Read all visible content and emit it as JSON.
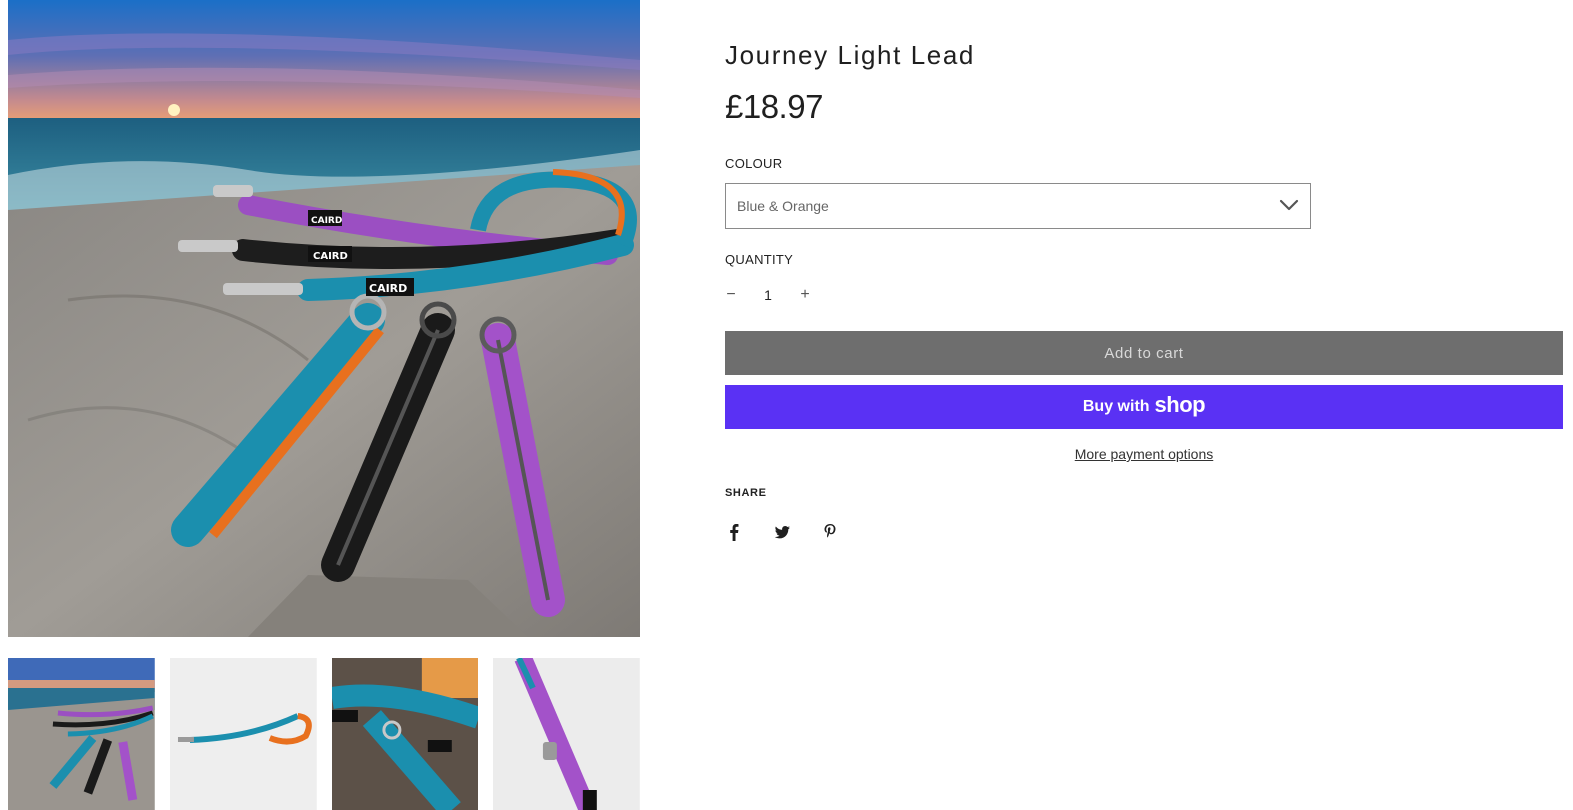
{
  "product": {
    "title": "Journey Light Lead",
    "price": "£18.97"
  },
  "gallery": {
    "main_image_icon": "leads-on-beach-photo",
    "thumbnails": [
      {
        "icon": "leads-on-beach-photo"
      },
      {
        "icon": "single-lead-white-photo"
      },
      {
        "icon": "lead-on-dog-collar-photo"
      },
      {
        "icon": "purple-lead-closeup-photo"
      }
    ],
    "brand_tag": "CAIRD"
  },
  "options": {
    "colour_label": "COLOUR",
    "colour_selected": "Blue & Orange",
    "quantity_label": "QUANTITY",
    "quantity_value": "1",
    "minus": "−",
    "plus": "+"
  },
  "actions": {
    "add_to_cart": "Add to cart",
    "buy_with": "Buy with",
    "shop_word": "shop",
    "more_payment": "More payment options"
  },
  "share": {
    "label": "SHARE",
    "icons": [
      "facebook-icon",
      "twitter-icon",
      "pinterest-icon"
    ]
  },
  "colors": {
    "add_to_cart_bg": "#6e6e6e",
    "shop_pay_purple": "#5a31f4"
  }
}
